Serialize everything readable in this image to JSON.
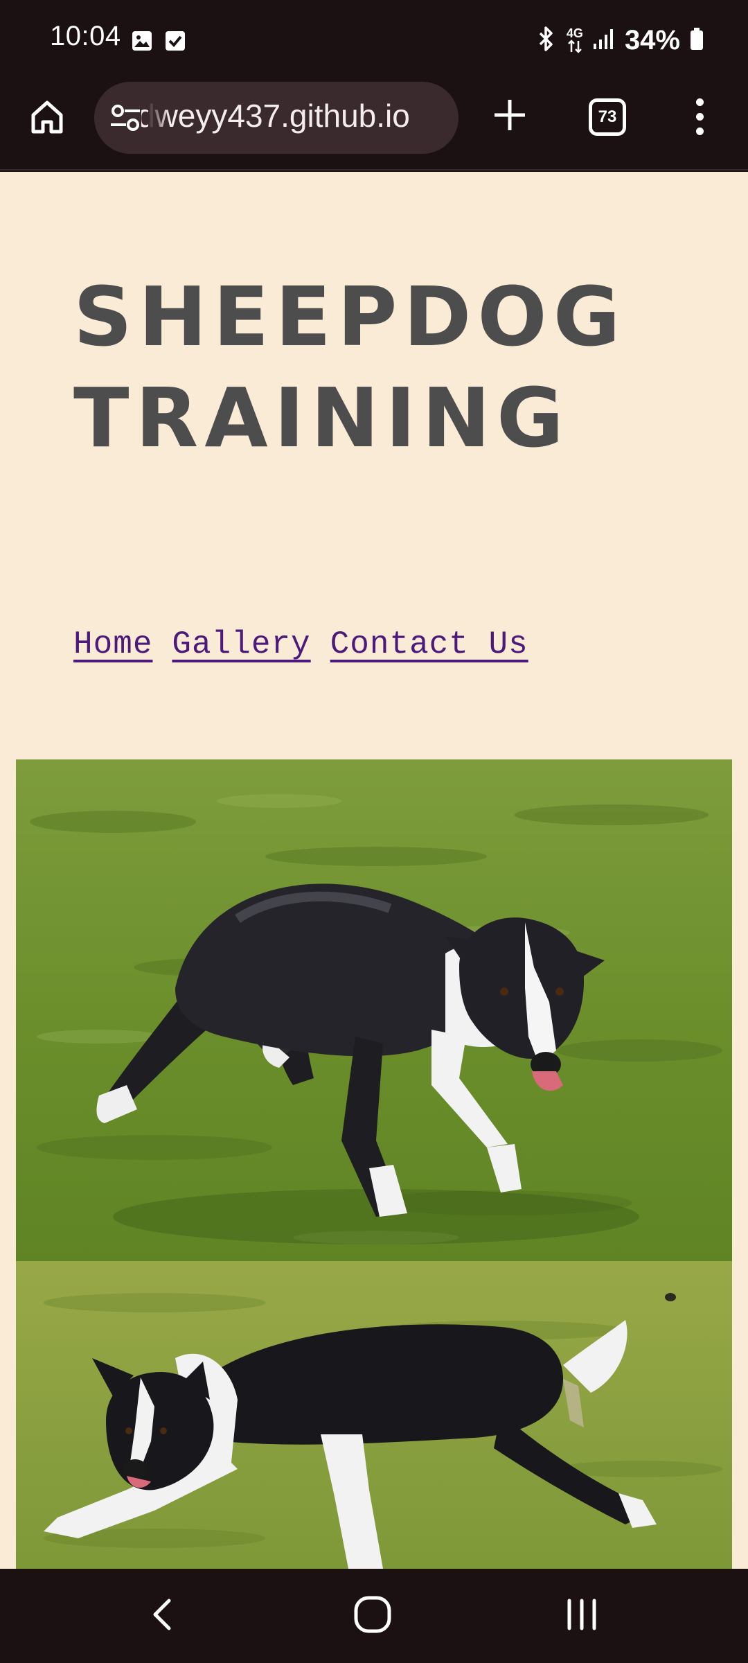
{
  "status_bar": {
    "time": "10:04",
    "network": "4G",
    "battery": "34%",
    "icons": [
      "gallery-icon",
      "checkbox-icon",
      "bluetooth-icon",
      "network-4g-icon",
      "signal-icon",
      "battery-icon"
    ]
  },
  "browser": {
    "url": "dweyy437.github.io",
    "tab_count": "73",
    "icons": [
      "home-icon",
      "site-settings-icon",
      "plus-icon",
      "tabs-icon",
      "more-vert-icon"
    ]
  },
  "page": {
    "title_line1": "SHEEPDOG",
    "title_line2": "TRAINING",
    "nav": {
      "home": "Home",
      "gallery": "Gallery",
      "contact": "Contact Us"
    },
    "colors": {
      "background": "#faebd7",
      "title": "#4d4d4d",
      "link": "#4b1a7a"
    }
  },
  "system_nav": {
    "icons": [
      "back-icon",
      "home-circle-icon",
      "recents-icon"
    ]
  }
}
